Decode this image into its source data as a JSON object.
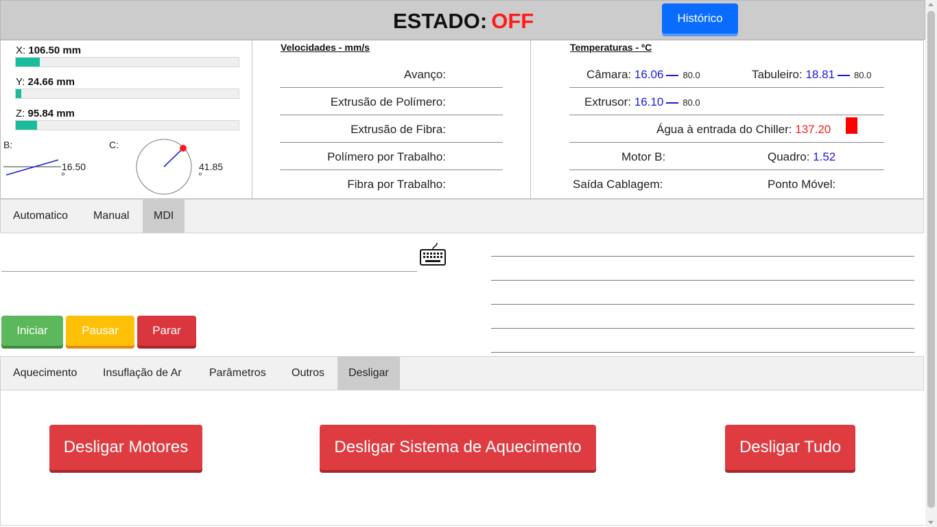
{
  "header": {
    "estado_label": "ESTADO:",
    "estado_value": "OFF",
    "historico_label": "Histórico"
  },
  "axes": {
    "x": {
      "label": "X:",
      "value": "106.50 mm",
      "level": 0.107
    },
    "y": {
      "label": "Y:",
      "value": "24.66 mm",
      "level": 0.025
    },
    "z": {
      "label": "Z:",
      "value": "95.84 mm",
      "level": 0.096
    },
    "b": {
      "label": "B:",
      "value": "16.50",
      "unit": "º"
    },
    "c": {
      "label": "C:",
      "value": "41.85",
      "unit": "º"
    }
  },
  "velocidades": {
    "title": "Velocidades - mm/s",
    "rows": [
      "Avanço:",
      "Extrusão de Polímero:",
      "Extrusão de Fibra:",
      "Polímero por Trabalho:",
      "Fibra por Trabalho:"
    ]
  },
  "temperaturas": {
    "title": "Temperaturas - ºC",
    "camara": {
      "label": "Câmara:",
      "value": "16.06",
      "setpoint": "80.0"
    },
    "tabuleiro": {
      "label": "Tabuleiro:",
      "value": "18.81",
      "setpoint": "80.0"
    },
    "extrusor": {
      "label": "Extrusor:",
      "value": "16.10",
      "setpoint": "80.0"
    },
    "agua": {
      "label": "Água à entrada do Chiller:",
      "value": "137.20"
    },
    "motor_b": {
      "label": "Motor B:"
    },
    "quadro": {
      "label": "Quadro:",
      "value": "1.52"
    },
    "saida": {
      "label": "Saída Cablagem:"
    },
    "ponto": {
      "label": "Ponto Móvel:"
    }
  },
  "mode_tabs": [
    {
      "label": "Automatico"
    },
    {
      "label": "Manual"
    },
    {
      "label": "MDI"
    }
  ],
  "mdi": {
    "input_value": "",
    "start_label": "Iniciar",
    "pause_label": "Pausar",
    "stop_label": "Parar"
  },
  "func_tabs": [
    {
      "label": "Aquecimento"
    },
    {
      "label": "Insuflação de Ar"
    },
    {
      "label": "Parâmetros"
    },
    {
      "label": "Outros"
    },
    {
      "label": "Desligar"
    }
  ],
  "desligar": {
    "motores_label": "Desligar Motores",
    "aquecimento_label": "Desligar Sistema de Aquecimento",
    "tudo_label": "Desligar Tudo"
  },
  "colors": {
    "accent_blue": "#0a6cff",
    "off_red": "#ff1a1a",
    "bar_fill": "#1abc9c",
    "value_blue": "#1a1adf"
  }
}
